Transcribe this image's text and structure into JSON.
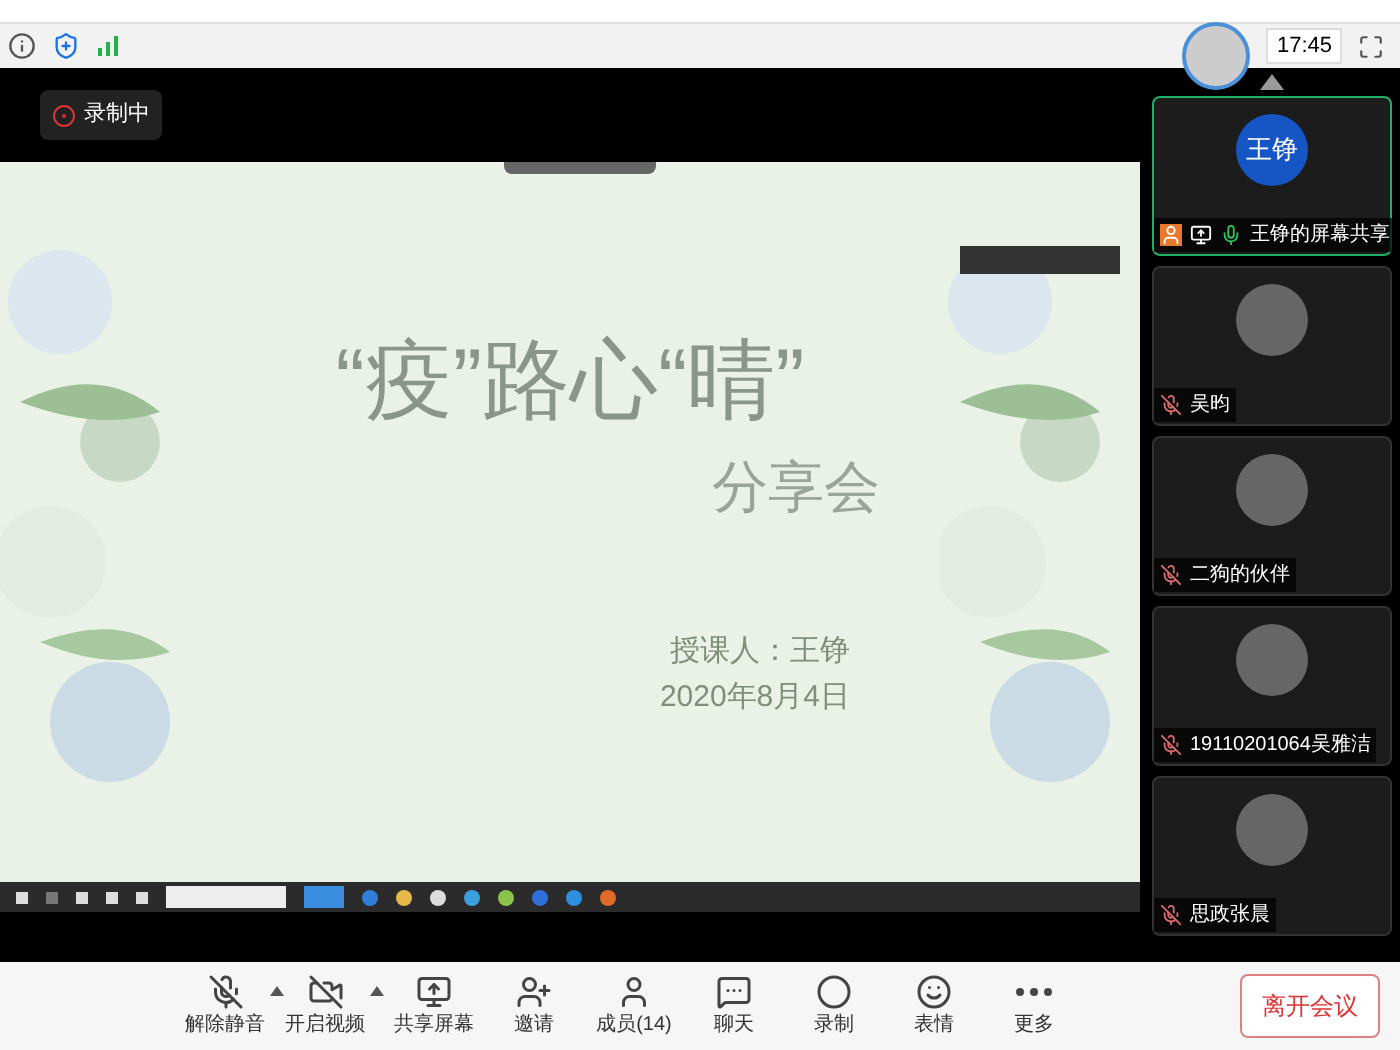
{
  "status_bar": {
    "time": "17:45"
  },
  "recording_badge": {
    "label": "录制中"
  },
  "slide": {
    "title": "“疫”路心“晴”",
    "subtitle": "分享会",
    "lecturer": "授课人：王铮",
    "date": "2020年8月4日"
  },
  "participants": [
    {
      "name": "王铮的屏幕共享",
      "avatar_text": "王铮",
      "muted": false,
      "active": true,
      "kind": "initials"
    },
    {
      "name": "吴昀",
      "muted": true,
      "active": false,
      "kind": "photo"
    },
    {
      "name": "二狗的伙伴",
      "muted": true,
      "active": false,
      "kind": "photo"
    },
    {
      "name": "19110201064吴雅洁",
      "muted": true,
      "active": false,
      "kind": "photo"
    },
    {
      "name": "思政张晨",
      "muted": true,
      "active": false,
      "kind": "photo"
    }
  ],
  "toolbar": [
    {
      "kind": "mic",
      "label": "解除静音",
      "has_menu": true
    },
    {
      "kind": "video",
      "label": "开启视频",
      "has_menu": true
    },
    {
      "kind": "share",
      "label": "共享屏幕",
      "has_menu": false
    },
    {
      "kind": "invite",
      "label": "邀请",
      "has_menu": false
    },
    {
      "kind": "members",
      "label": "成员(14)",
      "has_menu": false
    },
    {
      "kind": "chat",
      "label": "聊天",
      "has_menu": false
    },
    {
      "kind": "record",
      "label": "录制",
      "has_menu": false
    },
    {
      "kind": "emoji",
      "label": "表情",
      "has_menu": false
    },
    {
      "kind": "more",
      "label": "更多",
      "has_menu": false
    }
  ],
  "leave_button": {
    "label": "离开会议"
  }
}
